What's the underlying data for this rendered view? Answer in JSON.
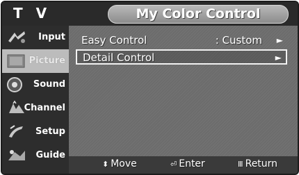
{
  "window": {
    "source_label": "T V",
    "menu_title": "My Color Control"
  },
  "sidebar": {
    "items": [
      {
        "label": "Input",
        "icon": "input-icon"
      },
      {
        "label": "Picture",
        "icon": "picture-icon",
        "active": true
      },
      {
        "label": "Sound",
        "icon": "sound-icon"
      },
      {
        "label": "Channel",
        "icon": "channel-icon"
      },
      {
        "label": "Setup",
        "icon": "setup-icon"
      },
      {
        "label": "Guide",
        "icon": "guide-icon"
      }
    ]
  },
  "menu": {
    "items": [
      {
        "label": "Easy Control",
        "value": ": Custom",
        "arrow": "►"
      },
      {
        "label": "Detail Control",
        "value": "",
        "arrow": "►",
        "selected": true
      }
    ]
  },
  "footer": {
    "move_icon": "⬍",
    "move_label": "Move",
    "enter_icon": "⏎",
    "enter_label": "Enter",
    "return_icon": "Ⅲ",
    "return_label": "Return"
  },
  "colors": {
    "background": "#6c6c6c",
    "sidebar": "#2d2d2d",
    "active_tab": "#bcbcbc",
    "title_pill": "#a5a5a5"
  }
}
